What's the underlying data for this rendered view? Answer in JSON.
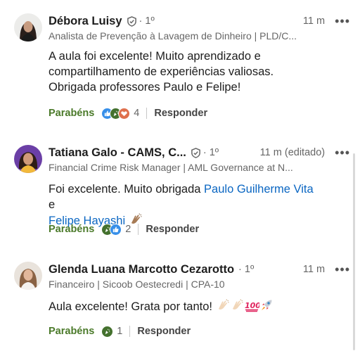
{
  "comments": [
    {
      "author": "Débora Luisy",
      "degree": "· 1º",
      "time": "11 m",
      "headline": "Analista de Prevenção à Lavagem de Dinheiro | PLD/C...",
      "body": "A aula foi excelente! Muito aprendizado e compartilhamento de experiências valiosas. Obrigada professores Paulo e Felipe!",
      "like_label": "Parabéns",
      "reaction_count": "4",
      "reply_label": "Responder"
    },
    {
      "author": "Tatiana Galo - CAMS, C...",
      "degree": "· 1º",
      "time": "11 m (editado)",
      "headline": "Financial Crime Risk Manager | AML Governance at N...",
      "body_prefix": "Foi excelente. Muito obrigada ",
      "mention_1": "Paulo Guilherme Vita",
      "body_and": " e",
      "mention_2": "Felipe Hayashi",
      "like_label": "Parabéns",
      "reaction_count": "2",
      "reply_label": "Responder"
    },
    {
      "author": "Glenda Luana Marcotto Cezarotto",
      "degree": "· 1º",
      "time": "11 m",
      "headline": "Financeiro | Sicoob Oestecredi | CPA-10",
      "body": "Aula excelente! Grata por tanto!",
      "like_label": "Parabéns",
      "reaction_count": "1",
      "reply_label": "Responder"
    }
  ],
  "icons": {
    "verified": "shield-check-icon",
    "more": "more-horizontal-icon",
    "reactions": [
      "like-icon",
      "celebrate-icon",
      "love-icon"
    ],
    "emoji": [
      "clapping-hands-emoji",
      "hundred-points-emoji",
      "rocket-emoji"
    ]
  },
  "colors": {
    "like_green": "#4b7a2a",
    "mention_blue": "#0a66c2",
    "muted": "#666666"
  }
}
